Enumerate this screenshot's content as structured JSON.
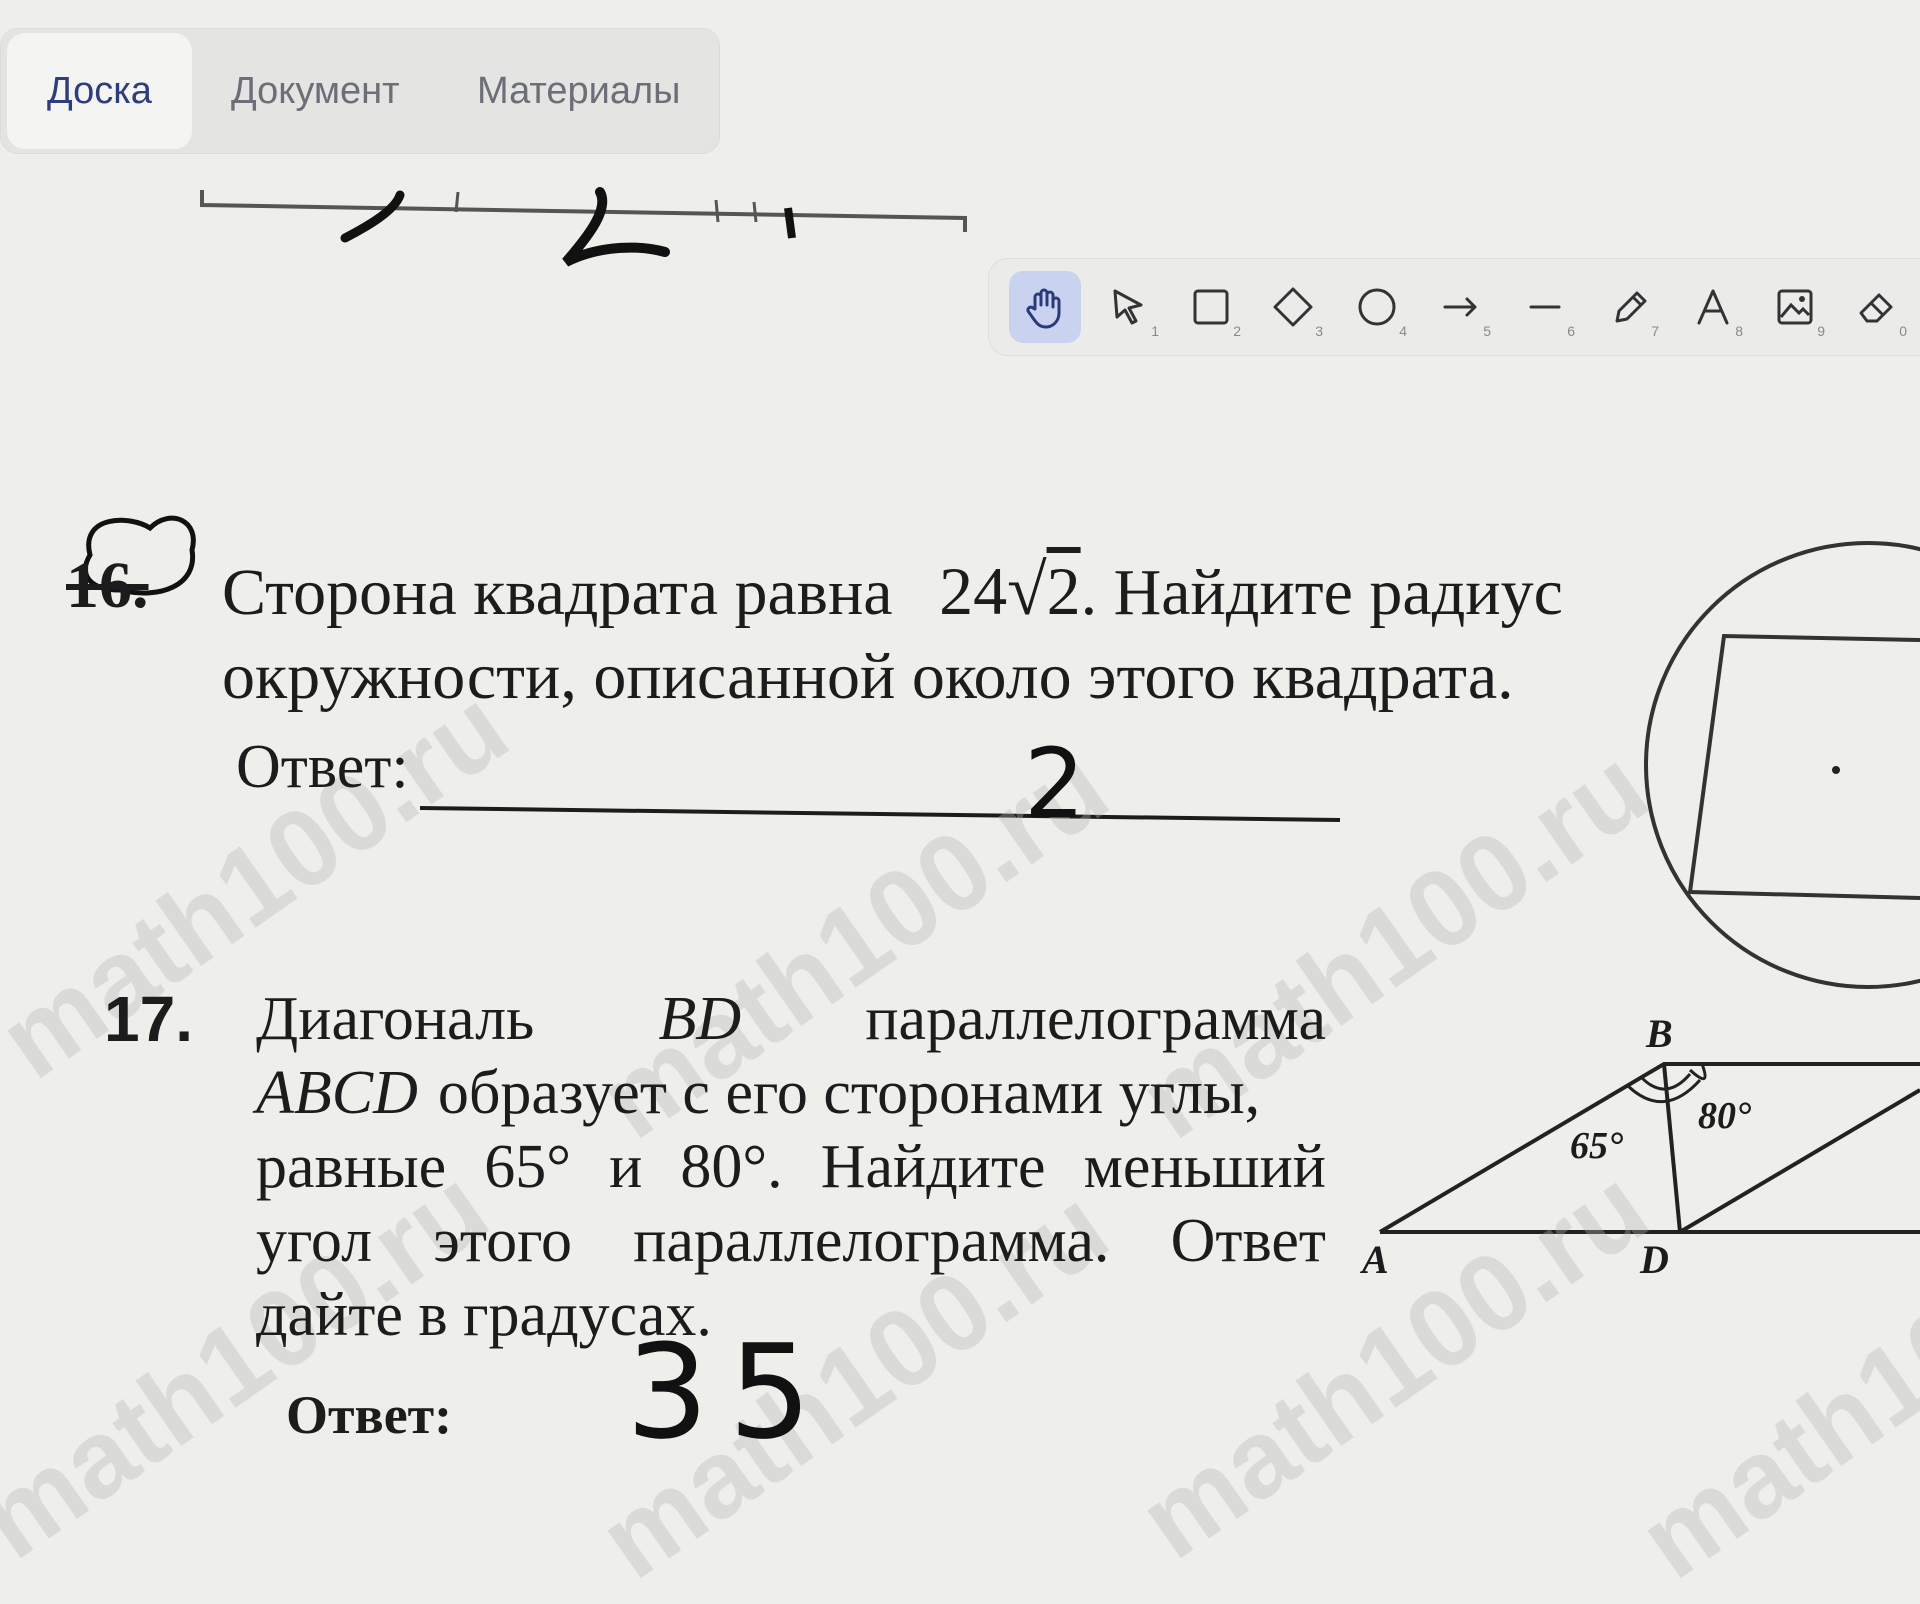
{
  "tabs": [
    {
      "label": "Доска",
      "active": true
    },
    {
      "label": "Документ",
      "active": false
    },
    {
      "label": "Материалы",
      "active": false
    }
  ],
  "toolbar": {
    "tools": [
      {
        "icon": "hand-icon",
        "shortcut": "",
        "active": true
      },
      {
        "icon": "select-arrow-icon",
        "shortcut": "1"
      },
      {
        "icon": "rectangle-icon",
        "shortcut": "2"
      },
      {
        "icon": "diamond-icon",
        "shortcut": "3"
      },
      {
        "icon": "circle-icon",
        "shortcut": "4"
      },
      {
        "icon": "arrow-icon",
        "shortcut": "5"
      },
      {
        "icon": "line-icon",
        "shortcut": "6"
      },
      {
        "icon": "pencil-icon",
        "shortcut": "7"
      },
      {
        "icon": "text-icon",
        "shortcut": "8"
      },
      {
        "icon": "image-icon",
        "shortcut": "9"
      },
      {
        "icon": "eraser-icon",
        "shortcut": "0"
      }
    ],
    "accent": "#c9d3ef"
  },
  "problem16": {
    "number": "16.",
    "text_line1": "Сторона квадрата равна",
    "formula_coef": "24",
    "formula_radicand": "2",
    "text_line1b": ". Найдите радиус",
    "text_line2": "окружности, описанной около этого квадрата.",
    "answer_label": "Ответ:",
    "handwritten_answer": "2"
  },
  "problem17": {
    "number": "17.",
    "line1": [
      "Диагональ",
      "BD",
      "параллелограмма"
    ],
    "line2_it": "ABCD",
    "line2": "образует с его сторонами углы,",
    "line3": [
      "равные",
      "65°",
      "и",
      "80°.",
      "Найдите",
      "меньший"
    ],
    "line4": [
      "угол",
      "этого",
      "параллелограмма.",
      "Ответ"
    ],
    "line5": "дайте в градусах.",
    "answer_label": "Ответ:",
    "handwritten_answer": "35",
    "figure": {
      "labels": {
        "A": "A",
        "B": "B",
        "D": "D"
      },
      "angle1": "65°",
      "angle2": "80°"
    }
  },
  "watermark": "math100.ru"
}
